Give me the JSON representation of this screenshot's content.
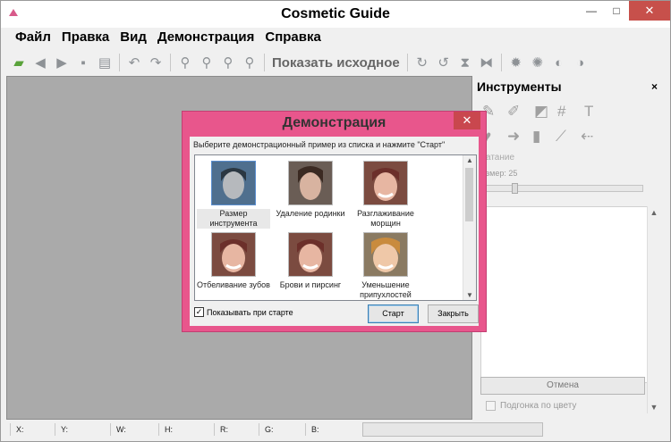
{
  "app": {
    "title": "Cosmetic Guide",
    "window_controls": {
      "minimize": "—",
      "maximize": "□",
      "close": "✕"
    }
  },
  "menu": [
    "Файл",
    "Правка",
    "Вид",
    "Демонстрация",
    "Справка"
  ],
  "toolbar": {
    "show_original_label": "Показать исходное",
    "icons": [
      "open-icon",
      "back-icon",
      "forward-icon",
      "save-icon",
      "print-icon",
      "undo-icon",
      "redo-icon",
      "zoom-in-icon",
      "zoom-out-icon",
      "zoom-fit-icon",
      "zoom-actual-icon",
      "rotate-cw-icon",
      "rotate-ccw-icon",
      "flip-vertical-icon",
      "flip-horizontal-icon",
      "brightness-icon",
      "contrast-icon",
      "saturation-icon",
      "tone-icon"
    ]
  },
  "tools_panel": {
    "title": "Инструменты",
    "close": "×",
    "group_title": "атание",
    "size_label": "змер: 25",
    "size_value": 25,
    "cancel_label": "Отмена",
    "color_fit_label": "Подгонка по цвету"
  },
  "statusbar": {
    "fields": [
      "X:",
      "Y:",
      "W:",
      "H:",
      "R:",
      "G:",
      "B:"
    ]
  },
  "dialog": {
    "title": "Демонстрация",
    "close": "✕",
    "instruction": "Выберите демонстрационный пример из списка и нажмите \"Старт\"",
    "items": [
      {
        "label": "Размер инструмента"
      },
      {
        "label": "Удаление родинки"
      },
      {
        "label": "Разглаживание морщин"
      },
      {
        "label": "Отбеливание зубов"
      },
      {
        "label": "Брови и пирсинг"
      },
      {
        "label": "Уменьшение припухлостей"
      }
    ],
    "show_on_start_label": "Показывать при старте",
    "show_on_start_checked": true,
    "start_label": "Старт",
    "close_label": "Закрыть"
  }
}
